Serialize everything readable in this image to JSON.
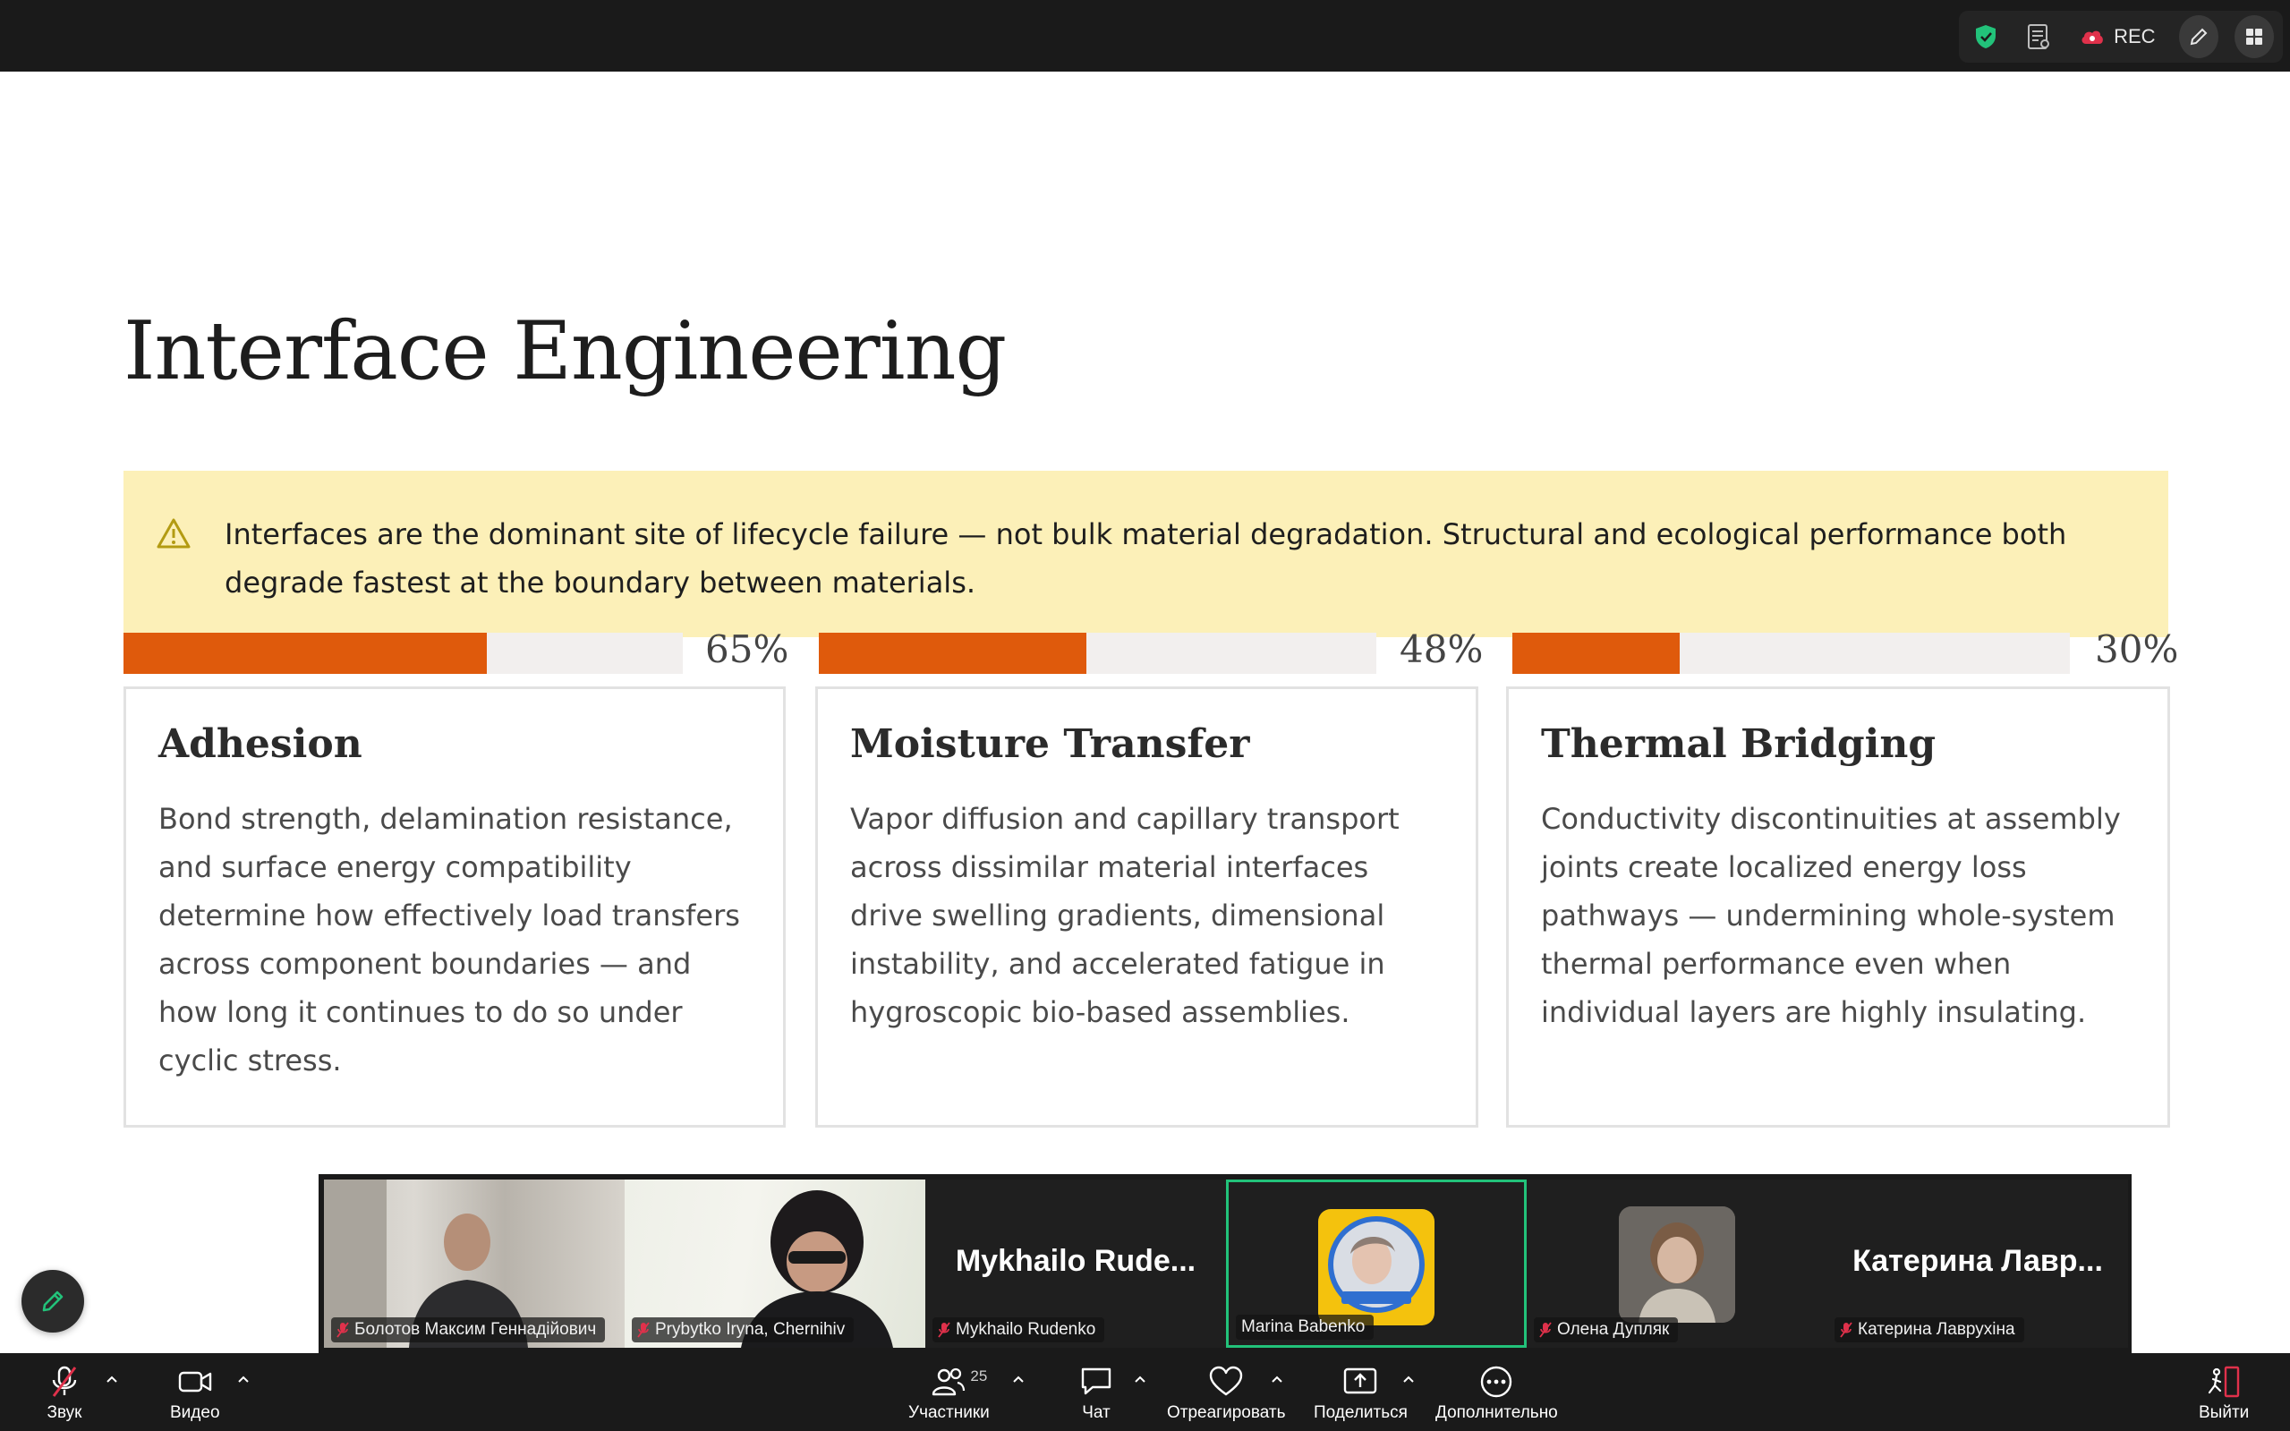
{
  "topbar": {
    "rec_label": "REC"
  },
  "slide": {
    "title": "Interface Engineering",
    "callout": "Interfaces are the dominant site of lifecycle failure — not bulk material degradation. Structural and ecological performance both degrade fastest at the boundary between materials.",
    "bars": [
      {
        "percent_label": "65%",
        "fill_fraction": 0.65
      },
      {
        "percent_label": "48%",
        "fill_fraction": 0.48
      },
      {
        "percent_label": "30%",
        "fill_fraction": 0.3
      }
    ],
    "cards": [
      {
        "title": "Adhesion",
        "text": "Bond strength, delamination resistance, and surface energy compatibility determine how effectively load transfers across component boundaries — and how long it continues to do so under cyclic stress."
      },
      {
        "title": "Moisture Transfer",
        "text": "Vapor diffusion and capillary transport across dissimilar material interfaces drive swelling gradients, dimensional instability, and accelerated fatigue in hygroscopic bio-based assemblies."
      },
      {
        "title": "Thermal Bridging",
        "text": "Conductivity discontinuities at assembly joints create localized energy loss pathways — undermining whole-system thermal performance even when individual layers are highly insulating."
      }
    ]
  },
  "participants": [
    {
      "name": "Болотов Максим Геннадійович",
      "muted": true
    },
    {
      "name": "Prybytko Iryna, Chernihiv",
      "muted": true
    },
    {
      "name": "Mykhailo Rudenko",
      "display": "Mykhailo  Rude...",
      "muted": true
    },
    {
      "name": "Marina Babenko",
      "muted": false,
      "active": true
    },
    {
      "name": "Олена Дупляк",
      "muted": true
    },
    {
      "name": "Катерина Лаврухіна",
      "display": "Катерина  Лавр...",
      "muted": true
    }
  ],
  "toolbar": {
    "audio": "Звук",
    "video": "Видео",
    "participants": "Участники",
    "participants_count": "25",
    "chat": "Чат",
    "react": "Отреагировать",
    "share": "Поделиться",
    "more": "Дополнительно",
    "leave": "Выйти"
  },
  "colors": {
    "accent_bar": "#df5a0c",
    "callout_bg": "#fcf0b8",
    "active_speaker": "#22c27a",
    "muted_icon": "#e0314b",
    "shield": "#22c27a"
  }
}
